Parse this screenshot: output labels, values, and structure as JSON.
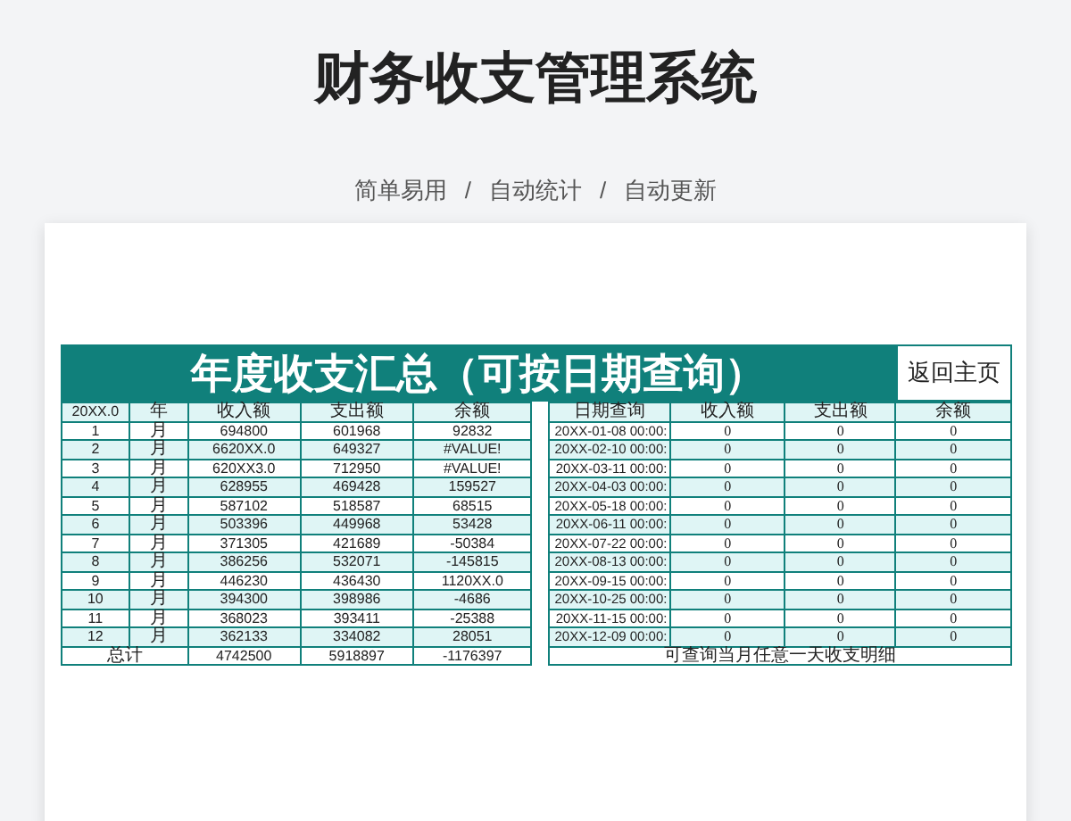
{
  "page": {
    "title": "财务收支管理系统",
    "features": [
      "简单易用",
      "自动统计",
      "自动更新"
    ],
    "separator": "/"
  },
  "sheet": {
    "title": "年度收支汇总（可按日期查询）",
    "home_button": "返回主页",
    "summary": {
      "columns": [
        "20XX.0",
        "年",
        "收入额",
        "支出额",
        "余额"
      ],
      "rows": [
        [
          "1",
          "月",
          "694800",
          "601968",
          "92832"
        ],
        [
          "2",
          "月",
          "6620XX.0",
          "649327",
          "#VALUE!"
        ],
        [
          "3",
          "月",
          "620XX3.0",
          "712950",
          "#VALUE!"
        ],
        [
          "4",
          "月",
          "628955",
          "469428",
          "159527"
        ],
        [
          "5",
          "月",
          "587102",
          "518587",
          "68515"
        ],
        [
          "6",
          "月",
          "503396",
          "449968",
          "53428"
        ],
        [
          "7",
          "月",
          "371305",
          "421689",
          "-50384"
        ],
        [
          "8",
          "月",
          "386256",
          "532071",
          "-145815"
        ],
        [
          "9",
          "月",
          "446230",
          "436430",
          "1120XX.0"
        ],
        [
          "10",
          "月",
          "394300",
          "398986",
          "-4686"
        ],
        [
          "11",
          "月",
          "368023",
          "393411",
          "-25388"
        ],
        [
          "12",
          "月",
          "362133",
          "334082",
          "28051"
        ]
      ],
      "total": [
        "总计",
        "4742500",
        "5918897",
        "-1176397"
      ]
    },
    "query": {
      "columns": [
        "日期查询",
        "收入额",
        "支出额",
        "余额"
      ],
      "rows": [
        [
          "20XX-01-08 00:00:",
          "0",
          "0",
          "0"
        ],
        [
          "20XX-02-10 00:00:",
          "0",
          "0",
          "0"
        ],
        [
          "20XX-03-11 00:00:",
          "0",
          "0",
          "0"
        ],
        [
          "20XX-04-03 00:00:",
          "0",
          "0",
          "0"
        ],
        [
          "20XX-05-18 00:00:",
          "0",
          "0",
          "0"
        ],
        [
          "20XX-06-11 00:00:",
          "0",
          "0",
          "0"
        ],
        [
          "20XX-07-22 00:00:",
          "0",
          "0",
          "0"
        ],
        [
          "20XX-08-13 00:00:",
          "0",
          "0",
          "0"
        ],
        [
          "20XX-09-15 00:00:",
          "0",
          "0",
          "0"
        ],
        [
          "20XX-10-25 00:00:",
          "0",
          "0",
          "0"
        ],
        [
          "20XX-11-15 00:00:",
          "0",
          "0",
          "0"
        ],
        [
          "20XX-12-09 00:00:",
          "0",
          "0",
          "0"
        ]
      ],
      "note": "可查询当月任意一天收支明细"
    }
  }
}
